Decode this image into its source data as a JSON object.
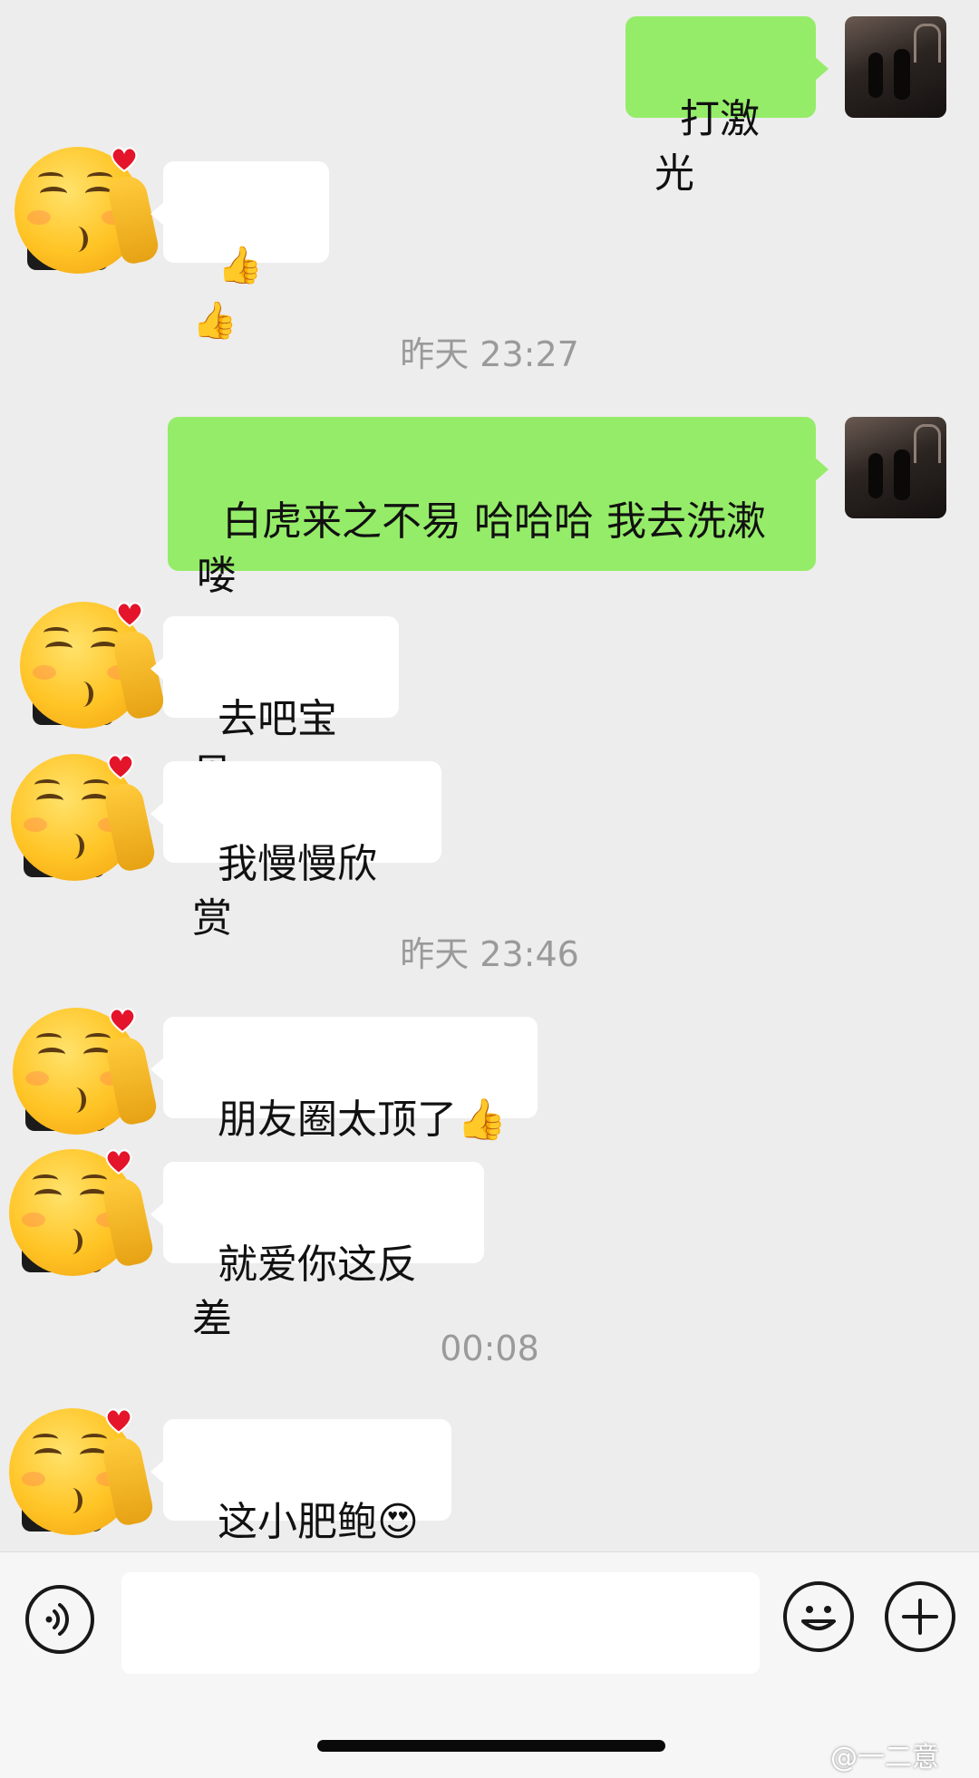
{
  "messages": [
    {
      "text": "打激光"
    },
    {
      "text": "👍👍"
    },
    {
      "text": "白虎来之不易 哈哈哈 我去洗漱\n喽"
    },
    {
      "text": "去吧宝贝"
    },
    {
      "text": "我慢慢欣赏"
    },
    {
      "text": "朋友圈太顶了👍"
    },
    {
      "text": "就爱你这反差"
    },
    {
      "text": "这小肥鲍😍"
    }
  ],
  "timestamps": [
    "昨天 23:27",
    "昨天 23:46",
    "00:08"
  ],
  "icons": {
    "voice": "voice-icon",
    "emoji": "emoji-icon",
    "plus": "plus-icon",
    "avatar_other": "kissing-emoji-icon",
    "avatar_me": "photo-avatar"
  },
  "colors": {
    "background": "#ededed",
    "my_bubble": "#95ec69",
    "their_bubble": "#ffffff",
    "timestamp": "#9a9a9a"
  },
  "input": {
    "value": "",
    "placeholder": ""
  },
  "watermark": "@一二意"
}
